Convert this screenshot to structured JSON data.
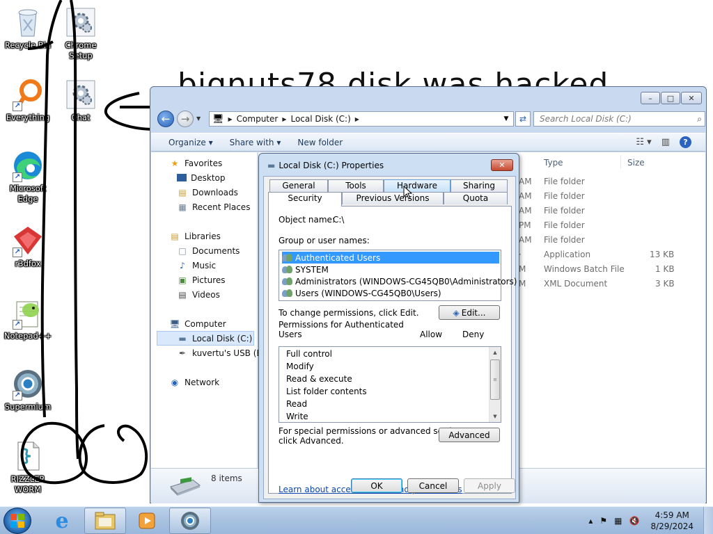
{
  "desktop": {
    "icons": [
      {
        "label": "Recycle Bin"
      },
      {
        "label": "Chrome Setup"
      },
      {
        "label": "Everything"
      },
      {
        "label": "Chat"
      },
      {
        "label": "Microsoft Edge"
      },
      {
        "label": "r3dfox"
      },
      {
        "label": "Notepad++"
      },
      {
        "label": "Supermium"
      },
      {
        "label": "RIZZLER WORM"
      }
    ],
    "background_text": "bignuts78 disk was hacked"
  },
  "explorer": {
    "address": [
      "Computer",
      "Local Disk (C:)"
    ],
    "search_placeholder": "Search Local Disk (C:)",
    "toolbar": {
      "organize": "Organize",
      "share_with": "Share with",
      "new_folder": "New folder"
    },
    "nav": {
      "favorites": "Favorites",
      "desktop": "Desktop",
      "downloads": "Downloads",
      "recent_places": "Recent Places",
      "libraries": "Libraries",
      "documents": "Documents",
      "music": "Music",
      "pictures": "Pictures",
      "videos": "Videos",
      "computer": "Computer",
      "local_disk": "Local Disk (C:)",
      "usb": "kuvertu's USB (E:)",
      "network": "Network"
    },
    "columns": {
      "type": "Type",
      "size": "Size"
    },
    "rows": [
      {
        "time": "AM",
        "type": "File folder",
        "size": ""
      },
      {
        "time": "AM",
        "type": "File folder",
        "size": ""
      },
      {
        "time": "AM",
        "type": "File folder",
        "size": ""
      },
      {
        "time": "PM",
        "type": "File folder",
        "size": ""
      },
      {
        "time": "AM",
        "type": "File folder",
        "size": ""
      },
      {
        "time": "·",
        "type": "Application",
        "size": "13 KB"
      },
      {
        "time": "M",
        "type": "Windows Batch File",
        "size": "1 KB"
      },
      {
        "time": "M",
        "type": "XML Document",
        "size": "3 KB"
      }
    ],
    "items_count": "8 items"
  },
  "dialog": {
    "title": "Local Disk (C:) Properties",
    "tabs_row1": [
      "General",
      "Tools",
      "Hardware",
      "Sharing"
    ],
    "tabs_row2": [
      "Security",
      "Previous Versions",
      "Quota"
    ],
    "object_name_label": "Object name:",
    "object_name_value": "C:\\",
    "group_label": "Group or user names:",
    "users": [
      "Authenticated Users",
      "SYSTEM",
      "Administrators (WINDOWS-CG45QB0\\Administrators)",
      "Users (WINDOWS-CG45QB0\\Users)"
    ],
    "change_perm_text": "To change permissions, click Edit.",
    "edit_button": "Edit...",
    "permissions_for_line1": "Permissions for Authenticated",
    "permissions_for_line2": "Users",
    "allow_header": "Allow",
    "deny_header": "Deny",
    "permissions": [
      "Full control",
      "Modify",
      "Read & execute",
      "List folder contents",
      "Read",
      "Write"
    ],
    "special_text_line1": "For special permissions or advanced settings,",
    "special_text_line2": "click Advanced.",
    "advanced_button": "Advanced",
    "learn_link": "Learn about access control and permissions",
    "ok": "OK",
    "cancel": "Cancel",
    "apply": "Apply"
  },
  "taskbar": {
    "time": "4:59 AM",
    "date": "8/29/2024"
  }
}
